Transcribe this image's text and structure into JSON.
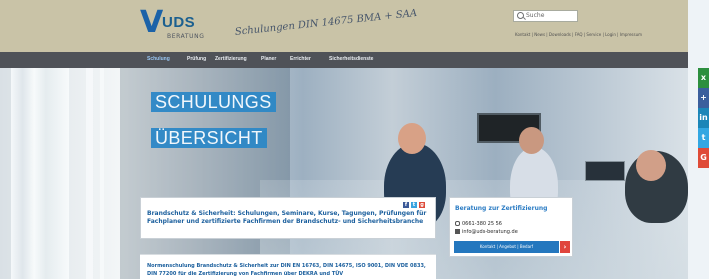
{
  "header": {
    "logo_text": "UDS",
    "logo_subtext": "BERATUNG",
    "slogan": "Schulungen DIN 14675 BMA + SAA",
    "search_placeholder": "Suche",
    "toplinks": "Kontakt | News | Downloads | FAQ | Service | Login | Impressum"
  },
  "nav": {
    "items": [
      "Schulung",
      "Prüfung",
      "Zertifizierung",
      "Planer",
      "Errichter",
      "Sicherheitsdienste"
    ]
  },
  "hero": {
    "title_line_1": "SCHULUNGS",
    "title_line_2": "ÜBERSICHT"
  },
  "info_card": {
    "text": "Brandschutz & Sicherheit: Schulungen, Seminare, Kurse, Tagungen, Prüfungen für Fachplaner und zertifizierte Fachfirmen der Brandschutz- und Sicherheitsbranche",
    "share_icons": [
      "f",
      "t",
      "g"
    ]
  },
  "consult": {
    "title": "Beratung zur Zertifizierung",
    "phone": "0661-380 25 56",
    "email": "info@uds-beratung.de",
    "button": "Kontakt | Angebot | Bedarf",
    "arrow": "›"
  },
  "bottom_card": {
    "text": "Normenschulung Brandschutz & Sicherheit zur DIN EN 16763, DIN 14675, ISO 9001, DIN VDE 0833, DIN 77200 für die Zertifizierung von Fachfirmen über DEKRA und TÜV"
  },
  "social": {
    "items": [
      "x",
      "+",
      "in",
      "t",
      "G"
    ],
    "colors": [
      "#2d8f3f",
      "#3b5f9d",
      "#1c86b8",
      "#33a7e2",
      "#df4b38"
    ]
  }
}
